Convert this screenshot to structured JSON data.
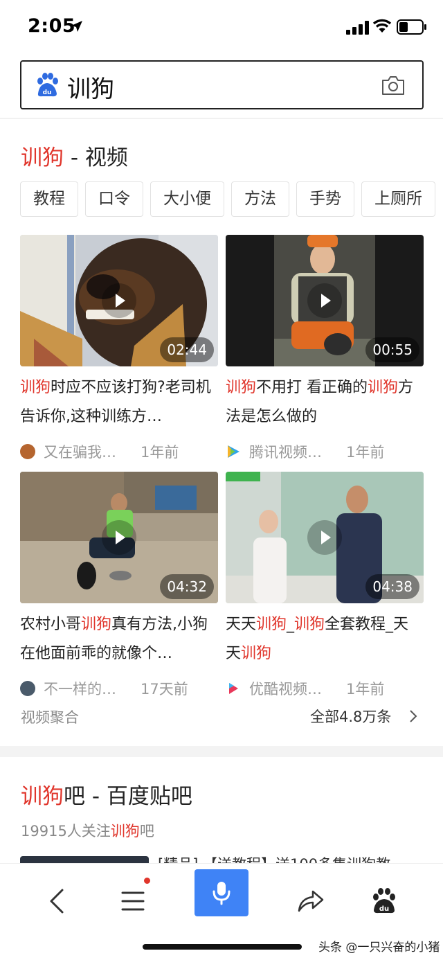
{
  "status": {
    "time": "2:05"
  },
  "search": {
    "query": "训狗"
  },
  "video_section": {
    "title_highlight": "训狗",
    "title_rest": " - 视频",
    "tags": [
      "教程",
      "口令",
      "大小便",
      "方法",
      "手势",
      "上厕所"
    ],
    "videos": [
      {
        "duration": "02:44",
        "title_parts": [
          {
            "t": "训狗",
            "hl": true
          },
          {
            "t": "时应不应该打狗?老司机告诉你,这种训练方…",
            "hl": false
          }
        ],
        "source": "又在骗我…",
        "time": "1年前",
        "avatar_color": "#b5652f"
      },
      {
        "duration": "00:55",
        "title_parts": [
          {
            "t": "训狗",
            "hl": true
          },
          {
            "t": "不用打 看正确的",
            "hl": false
          },
          {
            "t": "训狗",
            "hl": true
          },
          {
            "t": "方法是怎么做的",
            "hl": false
          }
        ],
        "source": "腾讯视频…",
        "time": "1年前",
        "avatar_color": "#2ea5e8"
      },
      {
        "duration": "04:32",
        "title_parts": [
          {
            "t": "农村小哥",
            "hl": false
          },
          {
            "t": "训狗",
            "hl": true
          },
          {
            "t": "真有方法,小狗在他面前乖的就像个…",
            "hl": false
          }
        ],
        "source": "不一样的…",
        "time": "17天前",
        "avatar_color": "#4a5a6a"
      },
      {
        "duration": "04:38",
        "title_parts": [
          {
            "t": "天天",
            "hl": false
          },
          {
            "t": "训狗",
            "hl": true
          },
          {
            "t": "_",
            "hl": false
          },
          {
            "t": "训狗",
            "hl": true
          },
          {
            "t": "全套教程_天天",
            "hl": false
          },
          {
            "t": "训狗",
            "hl": true
          }
        ],
        "source": "优酷视频…",
        "time": "1年前",
        "avatar_color": "#e8385a"
      }
    ],
    "aggregate_label": "视频聚合",
    "all_label": "全部4.8万条"
  },
  "tieba": {
    "title_highlight": "训狗",
    "title_rest": "吧 - 百度贴吧",
    "sub_prefix": "19915人关注",
    "sub_highlight": "训狗",
    "sub_suffix": "吧",
    "peek_text": "[精品] 【送教程】送100多集训狗教"
  },
  "watermark": "头条 @一只兴奋的小猪",
  "colors": {
    "highlight": "#e0352b",
    "voice_button": "#3f83f6"
  },
  "icons": [
    "location-arrow-icon",
    "signal-icon",
    "wifi-icon",
    "battery-icon",
    "baidu-paw-icon",
    "camera-icon",
    "back-icon",
    "menu-icon",
    "microphone-icon",
    "share-icon",
    "baidu-home-icon"
  ]
}
